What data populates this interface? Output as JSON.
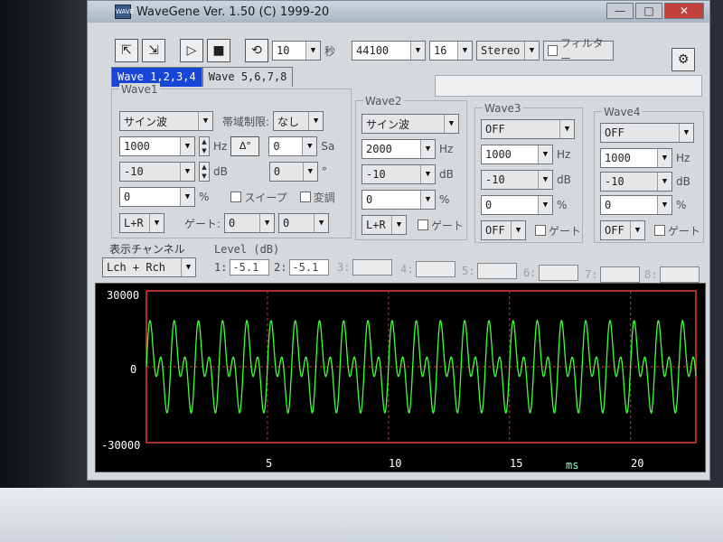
{
  "window": {
    "icon_text": "WAVE",
    "title": "WaveGene  Ver. 1.50  (C) 1999-20",
    "minimize": "—",
    "maximize": "□",
    "close": "✕"
  },
  "toolbar": {
    "duration": "10",
    "duration_unit": "秒",
    "sample_rate": "44100",
    "bits": "16",
    "channels": "Stereo",
    "filter_label": "フィルター"
  },
  "tabs": [
    {
      "label": "Wave 1,2,3,4",
      "active": true
    },
    {
      "label": "Wave 5,6,7,8",
      "active": false
    }
  ],
  "wave1": {
    "title": "Wave1",
    "waveform": "サイン波",
    "band_label": "帯域制限:",
    "band_value": "なし",
    "freq": "1000",
    "freq_unit": "Hz",
    "btn_label": "Δ°",
    "sa_value": "0",
    "sa_unit": "Sa",
    "level": "-10",
    "level_unit": "dB",
    "phase": "0",
    "phase_unit": "°",
    "percent": "0",
    "percent_unit": "%",
    "sweep_label": "スイープ",
    "mod_label": "変調",
    "channel": "L+R",
    "gate_label": "ゲート:",
    "gate_a": "0",
    "gate_b": "0"
  },
  "wave2": {
    "title": "Wave2",
    "waveform": "サイン波",
    "freq": "2000",
    "freq_unit": "Hz",
    "level": "-10",
    "level_unit": "dB",
    "percent": "0",
    "percent_unit": "%",
    "channel": "L+R",
    "gate_label": "ゲート"
  },
  "wave3": {
    "title": "Wave3",
    "waveform": "OFF",
    "freq": "1000",
    "freq_unit": "Hz",
    "level": "-10",
    "level_unit": "dB",
    "percent": "0",
    "percent_unit": "%",
    "channel": "OFF",
    "gate_label": "ゲート"
  },
  "wave4": {
    "title": "Wave4",
    "waveform": "OFF",
    "freq": "1000",
    "freq_unit": "Hz",
    "level": "-10",
    "level_unit": "dB",
    "percent": "0",
    "percent_unit": "%",
    "channel": "OFF",
    "gate_label": "ゲート"
  },
  "display": {
    "channel_label": "表示チャンネル",
    "channel_value": "Lch + Rch",
    "level_title": "Level (dB)",
    "levels": [
      {
        "n": "1:",
        "v": "-5.1"
      },
      {
        "n": "2:",
        "v": "-5.1"
      },
      {
        "n": "3:",
        "v": ""
      },
      {
        "n": "4:",
        "v": ""
      },
      {
        "n": "5:",
        "v": ""
      },
      {
        "n": "6:",
        "v": ""
      },
      {
        "n": "7:",
        "v": ""
      },
      {
        "n": "8:",
        "v": ""
      }
    ]
  },
  "scope": {
    "y_max_label": "30000",
    "y_zero_label": "0",
    "y_min_label": "-30000",
    "x_ticks": [
      "5",
      "10",
      "15",
      "20"
    ],
    "x_unit": "ms",
    "colors": {
      "frame": "#e23c32",
      "trace": "#3dff3a",
      "grid": "#c43a34"
    },
    "signal": {
      "components": [
        {
          "freq_hz": 1000,
          "level_db": -10
        },
        {
          "freq_hz": 2000,
          "level_db": -10
        }
      ],
      "x_range_ms": [
        0,
        22.7
      ],
      "y_range": [
        -30000,
        30000
      ]
    }
  }
}
